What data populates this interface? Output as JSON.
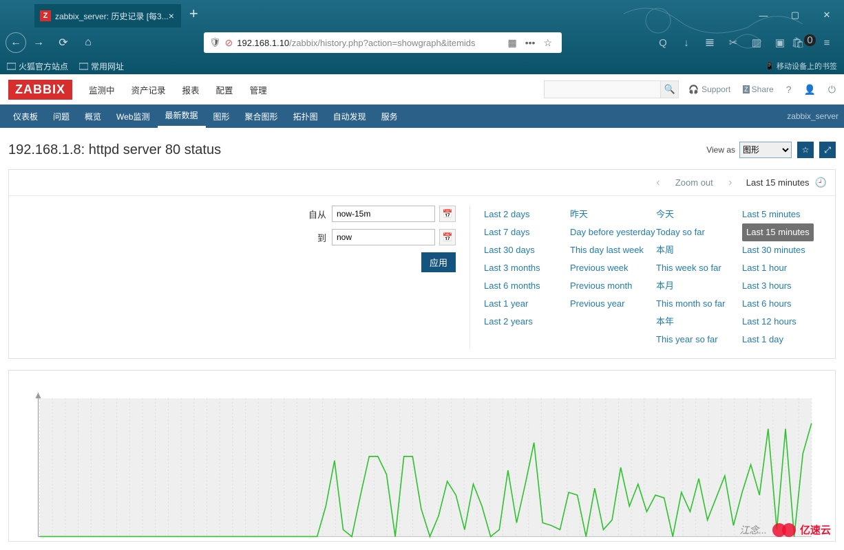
{
  "browser": {
    "tab_title": "zabbix_server: 历史记录 [每3...",
    "url_host": "192.168.1.10",
    "url_path_visible": "/zabbix/history.php?action=showgraph&itemids",
    "bookmarks": [
      "火狐官方站点",
      "常用网址"
    ],
    "mobile_label": "移动设备上的书签",
    "download_badge": "0"
  },
  "app": {
    "logo": "ZABBIX",
    "main_nav": [
      "监测中",
      "资产记录",
      "报表",
      "配置",
      "管理"
    ],
    "support": "Support",
    "share": "Share",
    "sub_nav": [
      "仪表板",
      "问题",
      "概览",
      "Web监测",
      "最新数据",
      "图形",
      "聚合图形",
      "拓扑图",
      "自动发现",
      "服务"
    ],
    "sub_nav_active_index": 4,
    "breadcrumb": "zabbix_server"
  },
  "page": {
    "title": "192.168.1.8: httpd server 80 status",
    "view_as_label": "View as",
    "view_as_value": "图形",
    "time_nav": {
      "zoom_out": "Zoom out",
      "active": "Last 15 minutes"
    },
    "from_label": "自从",
    "from_value": "now-15m",
    "to_label": "到",
    "to_value": "now",
    "apply": "应用",
    "ranges": {
      "col1": [
        "Last 2 days",
        "Last 7 days",
        "Last 30 days",
        "Last 3 months",
        "Last 6 months",
        "Last 1 year",
        "Last 2 years"
      ],
      "col2": [
        "昨天",
        "Day before yesterday",
        "This day last week",
        "Previous week",
        "Previous month",
        "Previous year"
      ],
      "col3": [
        "今天",
        "Today so far",
        "本周",
        "This week so far",
        "本月",
        "This month so far",
        "本年",
        "This year so far"
      ],
      "col4": [
        "Last 5 minutes",
        "Last 15 minutes",
        "Last 30 minutes",
        "Last 1 hour",
        "Last 3 hours",
        "Last 6 hours",
        "Last 12 hours",
        "Last 1 day"
      ],
      "selected": "Last 15 minutes"
    }
  },
  "chart_data": {
    "type": "line",
    "title": "",
    "xlabel": "",
    "ylabel": "",
    "x": [
      0,
      1,
      2,
      3,
      4,
      5,
      6,
      7,
      8,
      9,
      10,
      11,
      12,
      13,
      14,
      15,
      16,
      17,
      18,
      19,
      20,
      21,
      22,
      23,
      24,
      25,
      26,
      27,
      28,
      29,
      30,
      31,
      32,
      33,
      34,
      35,
      36,
      37,
      38,
      39,
      40,
      41,
      42,
      43,
      44,
      45,
      46,
      47,
      48,
      49,
      50,
      51,
      52,
      53,
      54,
      55,
      56,
      57,
      58,
      59,
      60,
      61,
      62,
      63,
      64,
      65,
      66,
      67,
      68,
      69,
      70,
      71,
      72,
      73,
      74,
      75,
      76,
      77,
      78,
      79,
      80,
      81,
      82,
      83,
      84,
      85,
      86,
      87,
      88,
      89
    ],
    "values": [
      0,
      0,
      0,
      0,
      0,
      0,
      0,
      0,
      0,
      0,
      0,
      0,
      0,
      0,
      0,
      0,
      0,
      0,
      0,
      0,
      0,
      0,
      0,
      0,
      0,
      0,
      0,
      0,
      0,
      0,
      0,
      0,
      0,
      22,
      55,
      5,
      0,
      30,
      58,
      58,
      45,
      0,
      58,
      58,
      20,
      0,
      15,
      40,
      30,
      5,
      38,
      22,
      0,
      5,
      48,
      10,
      38,
      68,
      10,
      8,
      5,
      32,
      30,
      0,
      35,
      5,
      12,
      50,
      22,
      38,
      18,
      30,
      28,
      0,
      32,
      18,
      42,
      12,
      28,
      44,
      8,
      32,
      52,
      30,
      78,
      5,
      78,
      0,
      60,
      82
    ],
    "ylim": [
      0,
      100
    ]
  },
  "watermark": "江念... 亿速云"
}
